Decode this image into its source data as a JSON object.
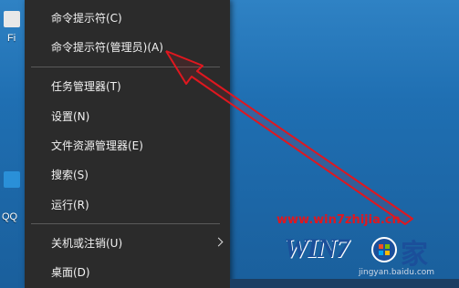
{
  "desktop": {
    "icons": [
      {
        "label": "Fi",
        "icon": "app-shortcut-icon"
      },
      {
        "label": "QQ",
        "icon": "qq-icon"
      }
    ]
  },
  "context_menu": {
    "items": [
      {
        "label": "命令提示符(C)"
      },
      {
        "label": "命令提示符(管理员)(A)"
      },
      {
        "label": "任务管理器(T)"
      },
      {
        "label": "设置(N)"
      },
      {
        "label": "文件资源管理器(E)"
      },
      {
        "label": "搜索(S)"
      },
      {
        "label": "运行(R)"
      },
      {
        "label": "关机或注销(U)",
        "has_submenu": true
      },
      {
        "label": "桌面(D)"
      }
    ]
  },
  "annotation": {
    "arrow_color": "#e0171f",
    "target": "命令提示符(管理员)(A)"
  },
  "watermark": {
    "url": "www.win7zhijia.cn",
    "logo_text": "WIN7",
    "home_char": "家",
    "site_text": "jingyan.baidu.com"
  },
  "colors": {
    "menu_bg": "#2b2b2b",
    "menu_text": "#f2f2f2",
    "separator": "#5a5a5a",
    "desktop_bg": "#1f6fb2"
  }
}
